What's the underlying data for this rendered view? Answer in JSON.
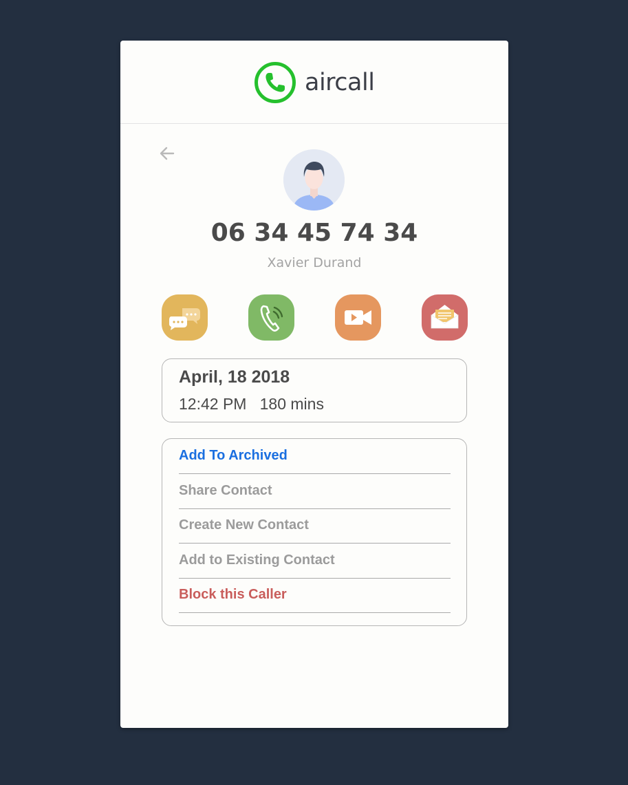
{
  "app": {
    "brand": "aircall",
    "brand_color": "#25c02d"
  },
  "nav": {
    "back_icon": "arrow-left-icon"
  },
  "contact": {
    "phone_number": "06 34 45 74 34",
    "name": "Xavier Durand",
    "avatar_icon": "person-avatar-icon"
  },
  "actions": [
    {
      "icon": "chat-bubbles-icon",
      "color": "#e2b65c"
    },
    {
      "icon": "phone-call-icon",
      "color": "#80b966"
    },
    {
      "icon": "video-camera-icon",
      "color": "#e5975f"
    },
    {
      "icon": "envelope-icon",
      "color": "#d16c6a"
    }
  ],
  "call": {
    "date": "April, 18 2018",
    "time": "12:42 PM",
    "duration": "180 mins"
  },
  "menu": {
    "items": [
      {
        "label": "Add To Archived",
        "color": "#1a6fe0"
      },
      {
        "label": "Share Contact",
        "color": "#9b9b9b"
      },
      {
        "label": "Create New Contact",
        "color": "#9b9b9b"
      },
      {
        "label": "Add to Existing Contact",
        "color": "#9b9b9b"
      },
      {
        "label": "Block this Caller",
        "color": "#c95d5b"
      }
    ]
  }
}
